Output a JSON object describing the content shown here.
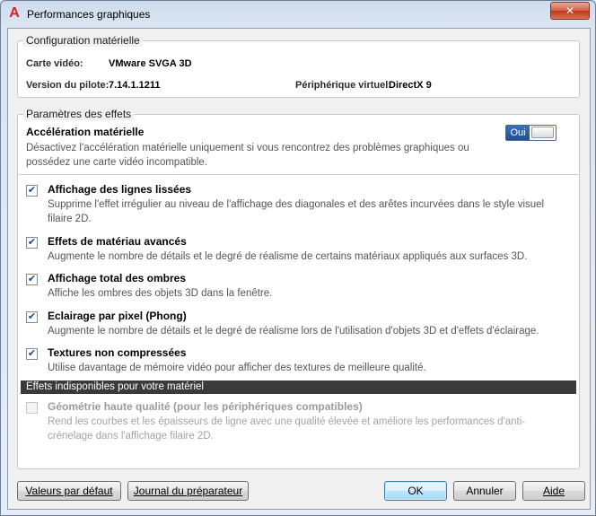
{
  "window": {
    "title": "Performances graphiques",
    "close_glyph": "✕",
    "app_icon": "A"
  },
  "hardware": {
    "legend": "Configuration matérielle",
    "video_card_label": "Carte vidéo:",
    "video_card_value": "VMware SVGA 3D",
    "driver_label": "Version du pilote:",
    "driver_value": "7.14.1.1211",
    "virtual_device_label": "Périphérique virtuel:",
    "virtual_device_value": "DirectX 9"
  },
  "effects": {
    "legend": "Paramètres des effets",
    "acceleration_title": "Accélération matérielle",
    "acceleration_desc": "Désactivez l'accélération matérielle uniquement si vous rencontrez des problèmes graphiques ou possédez une carte vidéo incompatible.",
    "toggle_label": "Oui",
    "options": [
      {
        "title": "Affichage des lignes lissées",
        "desc": "Supprime l'effet irrégulier au niveau de l'affichage des diagonales et des arêtes incurvées dans le style visuel filaire 2D.",
        "checked": true
      },
      {
        "title": "Effets de matériau avancés",
        "desc": "Augmente le nombre de détails et le degré de réalisme de certains matériaux appliqués aux surfaces 3D.",
        "checked": true
      },
      {
        "title": "Affichage total des ombres",
        "desc": "Affiche les ombres des objets 3D dans la fenêtre.",
        "checked": true
      },
      {
        "title": "Eclairage par pixel (Phong)",
        "desc": "Augmente le nombre de détails et le degré de réalisme lors de l'utilisation d'objets 3D et d'effets d'éclairage.",
        "checked": true
      },
      {
        "title": "Textures non compressées",
        "desc": "Utilise davantage de mémoire vidéo pour afficher des textures de meilleure qualité.",
        "checked": true
      }
    ],
    "unavailable_header": "Effets indisponibles pour votre matériel",
    "unavailable": {
      "title": "Géométrie haute qualité (pour les périphériques compatibles)",
      "desc": "Rend les courbes et les épaisseurs de ligne avec une qualité élevée et améliore les performances d'anti-crénelage dans l'affichage filaire 2D.",
      "checked": false
    }
  },
  "buttons": {
    "defaults": "Valeurs par défaut",
    "journal": "Journal du préparateur",
    "ok": "OK",
    "cancel": "Annuler",
    "help": "Aide"
  },
  "colors": {
    "accent": "#1f4f92",
    "close": "#c0361b",
    "dark_bar": "#3a3a3a"
  },
  "check_glyph": "✔"
}
